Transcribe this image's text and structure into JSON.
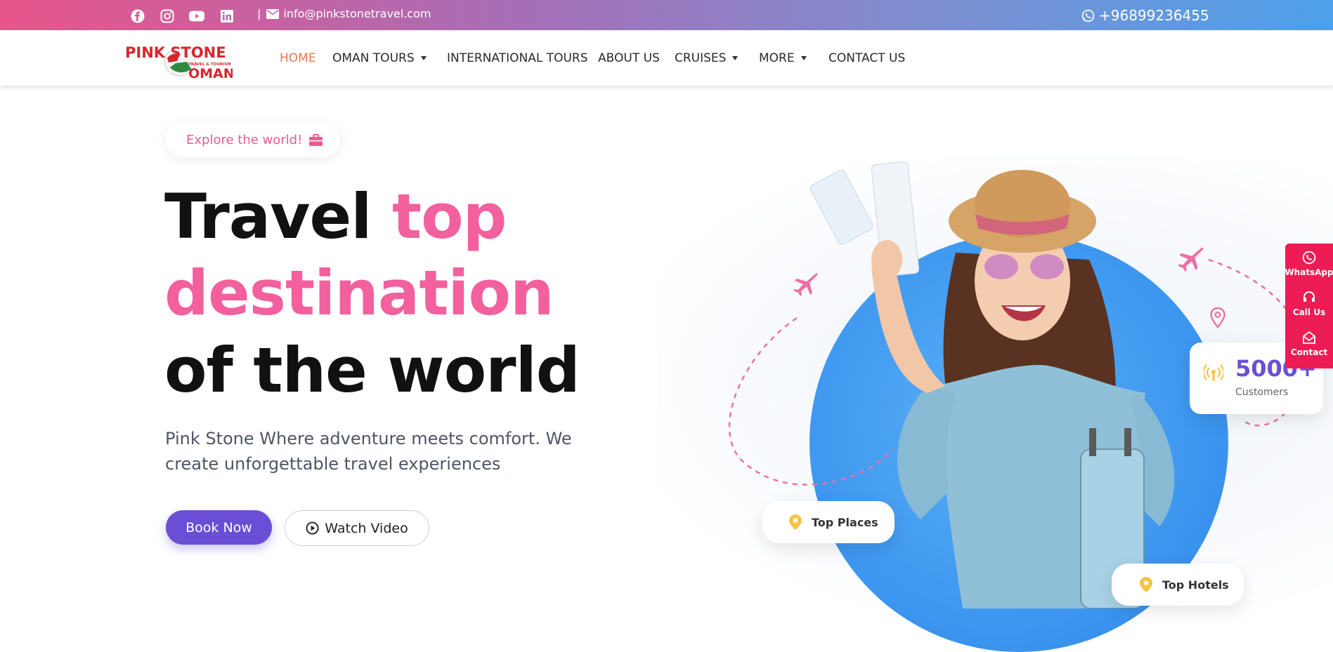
{
  "topbar": {
    "socials": [
      {
        "name": "facebook-icon"
      },
      {
        "name": "instagram-icon"
      },
      {
        "name": "youtube-icon"
      },
      {
        "name": "linkedin-icon"
      }
    ],
    "email": "info@pinkstonetravel.com",
    "phone": "+96899236455",
    "separator": "|"
  },
  "logo": {
    "line1": "PINK STONE",
    "line2": "TRAVEL & TOURISM",
    "line3": "OMAN"
  },
  "nav": {
    "items": [
      {
        "label": "HOME",
        "active": true,
        "dropdown": false
      },
      {
        "label": "OMAN TOURS",
        "active": false,
        "dropdown": true
      },
      {
        "label": "INTERNATIONAL TOURS",
        "active": false,
        "dropdown": false
      },
      {
        "label": "ABOUT US",
        "active": false,
        "dropdown": false
      },
      {
        "label": "CRUISES",
        "active": false,
        "dropdown": true
      },
      {
        "label": "MORE",
        "active": false,
        "dropdown": true
      },
      {
        "label": "CONTACT US",
        "active": false,
        "dropdown": false
      }
    ]
  },
  "hero": {
    "pill": "Explore the world!",
    "headline": {
      "line1_a": "Travel ",
      "line1_b": "top",
      "line2": "destination",
      "line3": "of the world"
    },
    "subtext": "Pink Stone Where adventure meets comfort. We create unforgettable travel experiences",
    "book_label": "Book Now",
    "video_label": "Watch Video"
  },
  "cards": {
    "places": "Top Places",
    "hotels": "Top Hotels",
    "stat_value": "5000+",
    "stat_label": "Customers"
  },
  "side": {
    "whatsapp": "WhatsApp",
    "call": "Call Us",
    "contact": "Contact"
  },
  "colors": {
    "accent_pink": "#f2609e",
    "purple": "#6a4fd6",
    "nav_active": "#e07a4f",
    "side_red": "#ed1c54"
  }
}
